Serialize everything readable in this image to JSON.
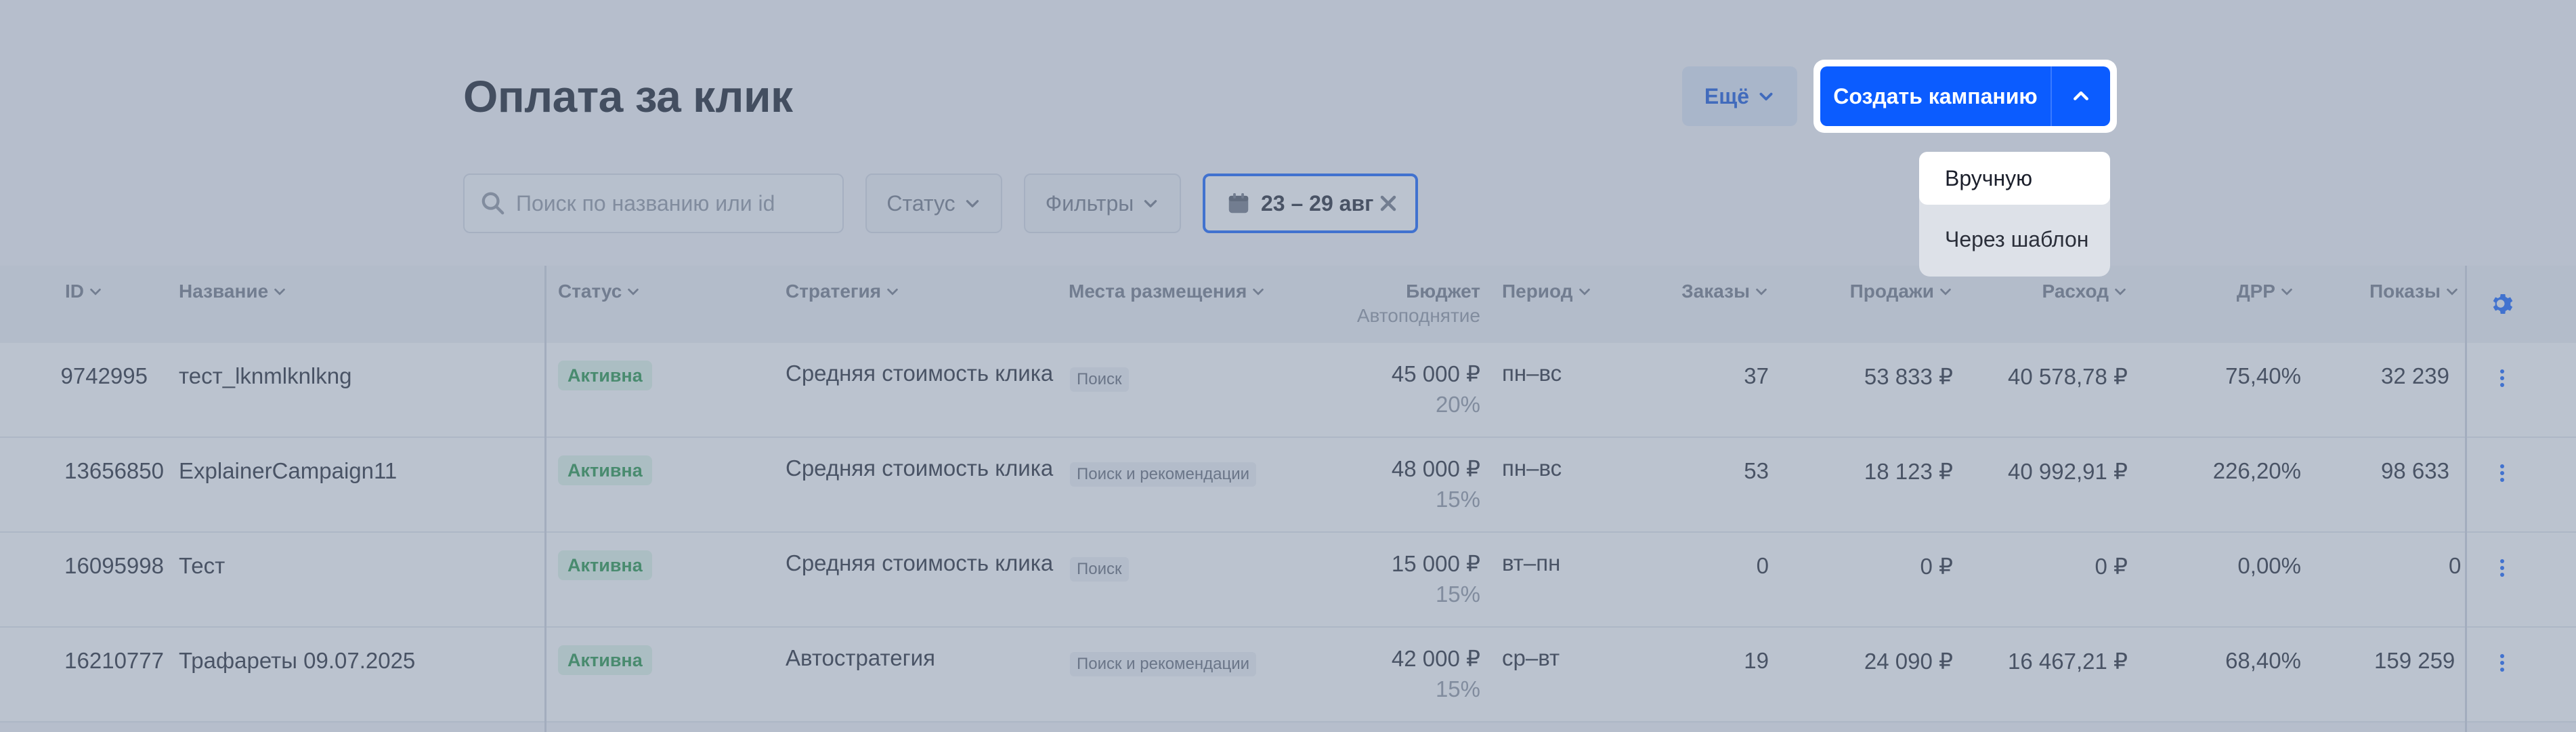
{
  "page": {
    "title": "Оплата за клик"
  },
  "header": {
    "more_label": "Ещё",
    "create_label": "Создать кампанию"
  },
  "filters": {
    "search_placeholder": "Поиск по названию или id",
    "status_label": "Статус",
    "filters_label": "Фильтры",
    "date_range": "23 – 29 авг"
  },
  "dropdown": {
    "items": [
      {
        "label": "Вручную"
      },
      {
        "label": "Через шаблон"
      }
    ]
  },
  "table": {
    "columns": {
      "id": "ID",
      "name": "Название",
      "status": "Статус",
      "strategy": "Стратегия",
      "placements": "Места размещения",
      "budget": "Бюджет",
      "budget_sub": "Автоподнятие",
      "period": "Период",
      "orders": "Заказы",
      "sales": "Продажи",
      "spend": "Расход",
      "drr": "ДРР",
      "impressions": "Показы"
    },
    "rows": [
      {
        "id": "9742995",
        "name": "тест_lknmlknlkng",
        "status": "Активна",
        "strategy": "Средняя стоимость клика",
        "placement": "Поиск",
        "budget": "45 000 ₽",
        "autoraise": "20%",
        "period": "пн–вс",
        "orders": "37",
        "sales": "53 833 ₽",
        "spend": "40 578,78 ₽",
        "drr": "75,40%",
        "impressions": "32 239"
      },
      {
        "id": "13656850",
        "name": "ExplainerCampaign11",
        "status": "Активна",
        "strategy": "Средняя стоимость клика",
        "placement": "Поиск и рекомендации",
        "budget": "48 000 ₽",
        "autoraise": "15%",
        "period": "пн–вс",
        "orders": "53",
        "sales": "18 123 ₽",
        "spend": "40 992,91 ₽",
        "drr": "226,20%",
        "impressions": "98 633"
      },
      {
        "id": "16095998",
        "name": "Тест",
        "status": "Активна",
        "strategy": "Средняя стоимость клика",
        "placement": "Поиск",
        "budget": "15 000 ₽",
        "autoraise": "15%",
        "period": "вт–пн",
        "orders": "0",
        "sales": "0 ₽",
        "spend": "0 ₽",
        "drr": "0,00%",
        "impressions": "0"
      },
      {
        "id": "16210777",
        "name": "Трафареты 09.07.2025",
        "status": "Активна",
        "strategy": "Автостратегия",
        "placement": "Поиск и рекомендации",
        "budget": "42 000 ₽",
        "autoraise": "15%",
        "period": "ср–вт",
        "orders": "19",
        "sales": "24 090 ₽",
        "spend": "16 467,21 ₽",
        "drr": "68,40%",
        "impressions": "159 259"
      }
    ]
  },
  "colors": {
    "accent": "#0b5cff",
    "active_badge_bg": "#dff5e6",
    "active_badge_text": "#1a8f3e",
    "overlay": "rgba(120,136,160,0.5)"
  }
}
